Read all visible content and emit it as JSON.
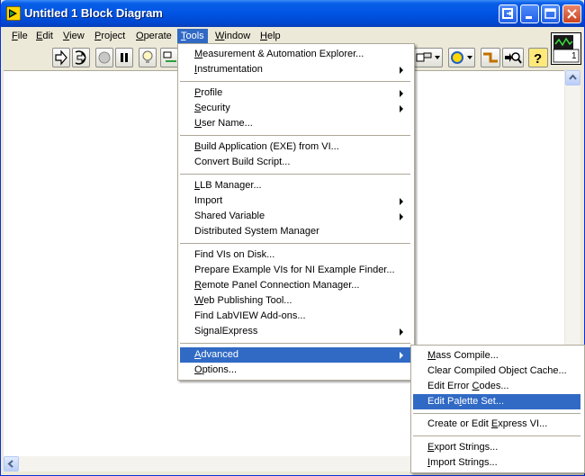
{
  "window": {
    "title": "Untitled 1 Block Diagram"
  },
  "menubar": [
    {
      "label": "File",
      "accel": "F",
      "rest": "ile"
    },
    {
      "label": "Edit",
      "accel": "E",
      "rest": "dit"
    },
    {
      "label": "View",
      "accel": "V",
      "rest": "iew"
    },
    {
      "label": "Project",
      "accel": "P",
      "rest": "roject"
    },
    {
      "label": "Operate",
      "accel": "O",
      "rest": "perate"
    },
    {
      "label": "Tools",
      "accel": "T",
      "rest": "ools"
    },
    {
      "label": "Window",
      "accel": "W",
      "rest": "indow"
    },
    {
      "label": "Help",
      "accel": "H",
      "rest": "elp"
    }
  ],
  "vi_icon": {
    "number": "1"
  },
  "tools_menu": [
    {
      "pre": "",
      "accel": "M",
      "post": "easurement & Automation Explorer..."
    },
    {
      "pre": "",
      "accel": "I",
      "post": "nstrumentation"
    },
    {
      "pre": "",
      "accel": "P",
      "post": "rofile"
    },
    {
      "pre": "",
      "accel": "S",
      "post": "ecurity"
    },
    {
      "pre": "",
      "accel": "U",
      "post": "ser Name..."
    },
    {
      "pre": "",
      "accel": "B",
      "post": "uild Application (EXE) from VI..."
    },
    {
      "pre": "Convert Build Script...",
      "accel": "",
      "post": ""
    },
    {
      "pre": "",
      "accel": "L",
      "post": "LB Manager..."
    },
    {
      "pre": "Import",
      "accel": "",
      "post": ""
    },
    {
      "pre": "Shared Variable",
      "accel": "",
      "post": ""
    },
    {
      "pre": "Distributed System Manager",
      "accel": "",
      "post": ""
    },
    {
      "pre": "Find VIs on Disk...",
      "accel": "",
      "post": ""
    },
    {
      "pre": "Prepare Example VIs for NI Example Finder...",
      "accel": "",
      "post": ""
    },
    {
      "pre": "",
      "accel": "R",
      "post": "emote Panel Connection Manager..."
    },
    {
      "pre": "",
      "accel": "W",
      "post": "eb Publishing Tool..."
    },
    {
      "pre": "Find LabVIEW Add-ons...",
      "accel": "",
      "post": ""
    },
    {
      "pre": "SignalExpress",
      "accel": "",
      "post": ""
    },
    {
      "pre": "",
      "accel": "A",
      "post": "dvanced"
    },
    {
      "pre": "",
      "accel": "O",
      "post": "ptions..."
    }
  ],
  "advanced_menu": [
    {
      "pre": "",
      "accel": "M",
      "post": "ass Compile..."
    },
    {
      "pre": "Clear Compiled Object Cache...",
      "accel": "",
      "post": ""
    },
    {
      "pre": "Edit Error ",
      "accel": "C",
      "post": "odes..."
    },
    {
      "pre": "Edit Pa",
      "accel": "l",
      "post": "ette Set..."
    },
    {
      "pre": "Create or Edit ",
      "accel": "E",
      "post": "xpress VI..."
    },
    {
      "pre": "",
      "accel": "E",
      "post": "xport Strings..."
    },
    {
      "pre": "",
      "accel": "I",
      "post": "mport Strings..."
    }
  ]
}
